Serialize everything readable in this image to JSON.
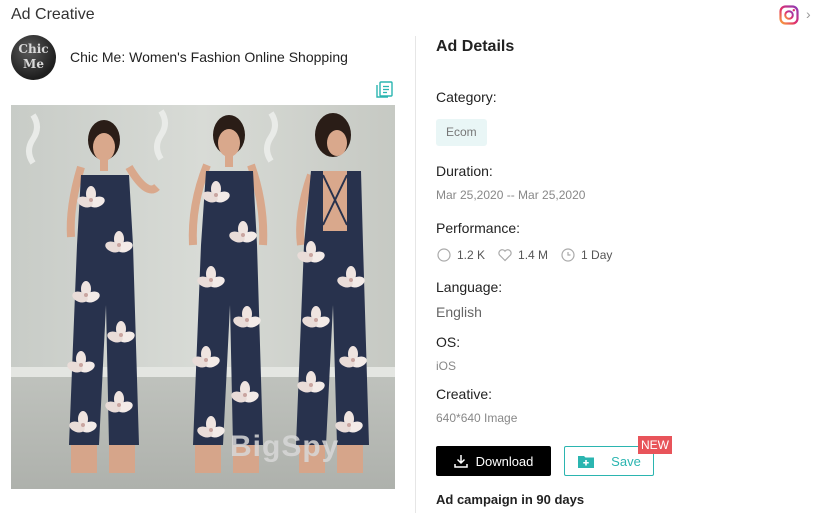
{
  "header": {
    "title": "Ad Creative",
    "platform_icon": "instagram-icon",
    "chevron": "›"
  },
  "advertiser": {
    "avatar_text_line1": "Chic",
    "avatar_text_line2": "Me",
    "name": "Chic Me: Women's Fashion Online Shopping"
  },
  "creative_image": {
    "watermark": "BigSpy",
    "description_icon": "copy-icon"
  },
  "details": {
    "title": "Ad Details",
    "category_label": "Category:",
    "category_value": "Ecom",
    "duration_label": "Duration:",
    "duration_value": "Mar 25,2020 -- Mar 25,2020",
    "performance_label": "Performance:",
    "comments": "1.2 K",
    "likes": "1.4 M",
    "days": "1 Day",
    "language_label": "Language:",
    "language_value": "English",
    "os_label": "OS:",
    "os_value": "iOS",
    "creative_label": "Creative:",
    "creative_value": "640*640 Image"
  },
  "actions": {
    "download_label": "Download",
    "save_label": "Save",
    "new_badge": "NEW"
  },
  "campaign": {
    "title": "Ad campaign in 90 days"
  },
  "colors": {
    "accent": "#2bb5b0",
    "badge_bg": "#e9f6f6",
    "new_badge": "#e8545a",
    "download_bg": "#000000"
  }
}
